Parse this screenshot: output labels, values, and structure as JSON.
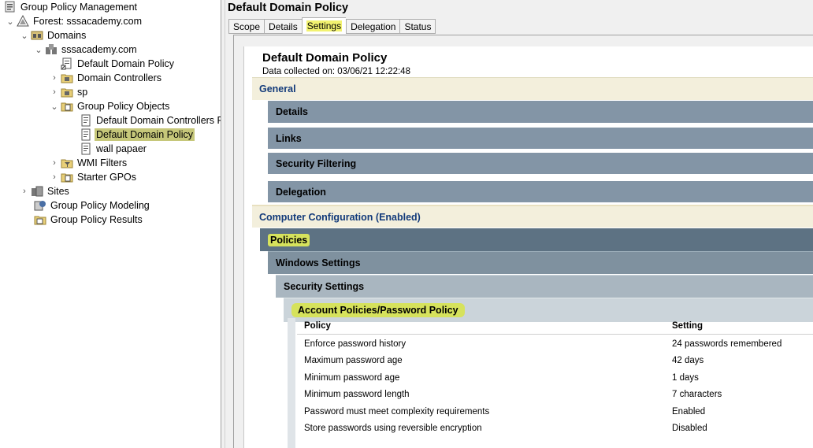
{
  "tree": {
    "items": [
      {
        "label": "Group Policy Management",
        "icon": "gpmc-console-icon",
        "expander": ""
      },
      {
        "label": "Forest: sssacademy.com",
        "icon": "forest-icon",
        "expander": "v"
      },
      {
        "label": "Domains",
        "icon": "",
        "expander": "v"
      },
      {
        "label": "sssacademy.com",
        "icon": "domain-icon",
        "expander": "v"
      },
      {
        "label": "Default Domain Policy",
        "icon": "gpo-link-icon",
        "expander": ""
      },
      {
        "label": "Domain Controllers",
        "icon": "ou-folder-icon",
        "expander": ">"
      },
      {
        "label": "sp",
        "icon": "ou-folder-icon",
        "expander": ">"
      },
      {
        "label": "Group Policy Objects",
        "icon": "gpo-folder-icon",
        "expander": "v"
      },
      {
        "label": "Default Domain Controllers Po",
        "icon": "gpo-script-icon",
        "expander": ""
      },
      {
        "label": "Default Domain Policy",
        "icon": "gpo-script-icon",
        "expander": ""
      },
      {
        "label": "wall papaer",
        "icon": "gpo-script-icon",
        "expander": ""
      },
      {
        "label": "WMI Filters",
        "icon": "wmi-folder-icon",
        "expander": ">"
      },
      {
        "label": "Starter GPOs",
        "icon": "starter-gpo-folder-icon",
        "expander": ">"
      },
      {
        "label": "Sites",
        "icon": "sites-icon",
        "expander": ">"
      },
      {
        "label": "Group Policy Modeling",
        "icon": "modeling-icon",
        "expander": ""
      },
      {
        "label": "Group Policy Results",
        "icon": "results-icon",
        "expander": ""
      }
    ]
  },
  "header": {
    "title": "Default Domain Policy",
    "tabs": [
      {
        "label": "Scope"
      },
      {
        "label": "Details"
      },
      {
        "label": "Settings"
      },
      {
        "label": "Delegation"
      },
      {
        "label": "Status"
      }
    ],
    "active_tab": "Settings"
  },
  "report": {
    "title": "Default Domain Policy",
    "data_collected": "Data collected on: 03/06/21 12:22:48",
    "general": "General",
    "general_items": [
      "Details",
      "Links",
      "Security Filtering",
      "Delegation"
    ],
    "computer_config": "Computer Configuration (Enabled)",
    "policies": "Policies",
    "windows_settings": "Windows Settings",
    "security_settings": "Security Settings",
    "account_policies": "Account Policies/Password Policy",
    "table": {
      "headers": [
        "Policy",
        "Setting"
      ],
      "rows": [
        [
          "Enforce password history",
          "24 passwords remembered"
        ],
        [
          "Maximum password age",
          "42 days"
        ],
        [
          "Minimum password age",
          "1 days"
        ],
        [
          "Minimum password length",
          "7 characters"
        ],
        [
          "Password must meet complexity requirements",
          "Enabled"
        ],
        [
          "Store passwords using reversible encryption",
          "Disabled"
        ]
      ]
    }
  },
  "colors": {
    "selection": "#c6c77a",
    "highlight": "#d6e25c",
    "section_text": "#123a7a"
  }
}
